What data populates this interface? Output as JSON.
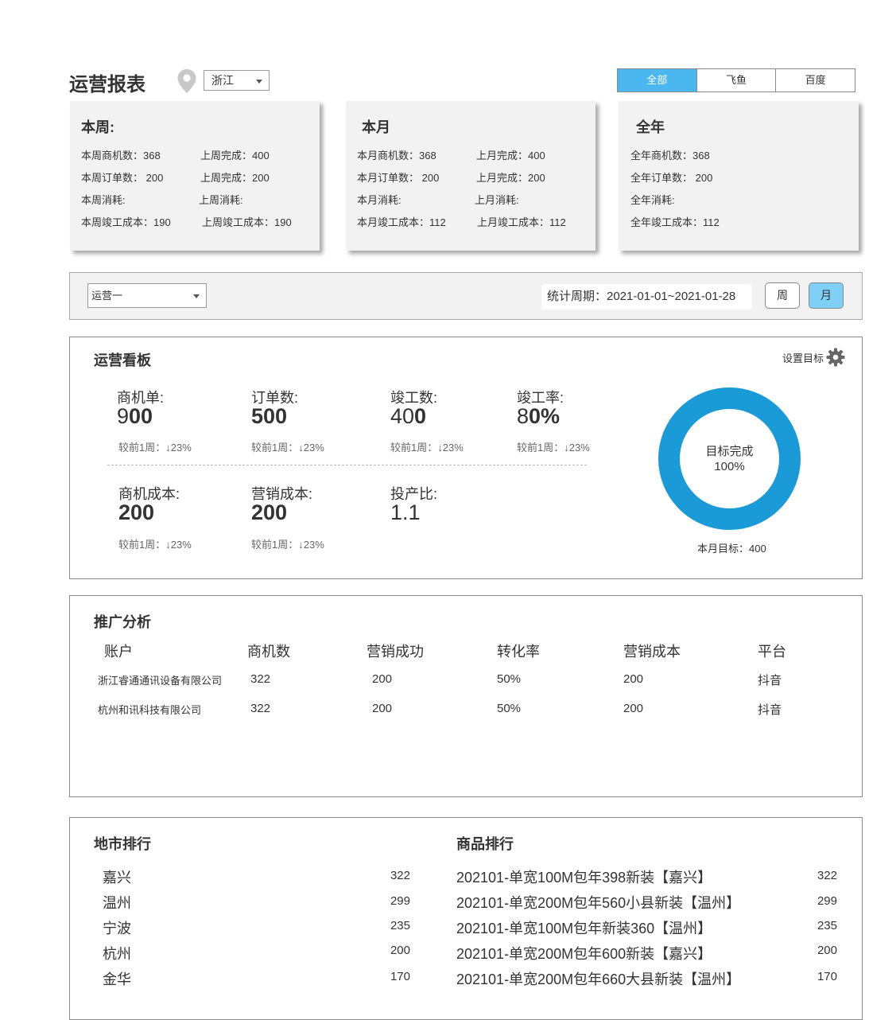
{
  "header": {
    "title": "运营报表",
    "province": "浙江",
    "platform_tabs": [
      "全部",
      "飞鱼",
      "百度"
    ]
  },
  "cards": [
    {
      "title": "本周:",
      "rows": [
        [
          "本周商机数：368",
          "上周完成：400"
        ],
        [
          "本周订单数： 200",
          "上周完成：200"
        ],
        [
          "本周消耗:",
          "上周消耗:"
        ],
        [
          "本周竣工成本：190",
          "上周竣工成本：190"
        ]
      ]
    },
    {
      "title": "本月",
      "rows": [
        [
          "本月商机数：368",
          "上月完成：400"
        ],
        [
          "本月订单数： 200",
          "上月完成：200"
        ],
        [
          "本月消耗:",
          "上月消耗:"
        ],
        [
          "本月竣工成本：112",
          "上月竣工成本：112"
        ]
      ]
    },
    {
      "title": "全年",
      "rows": [
        [
          "全年商机数：368",
          ""
        ],
        [
          "全年订单数： 200",
          ""
        ],
        [
          "全年消耗:",
          ""
        ],
        [
          "全年竣工成本：112",
          ""
        ]
      ]
    }
  ],
  "filter": {
    "operator": "运营一",
    "period": "统计周期：2021-01-01~2021-01-28",
    "week_label": "周",
    "month_label": "月"
  },
  "dashboard": {
    "title": "运营看板",
    "settings_label": "设置目标",
    "metrics": [
      {
        "label": "商机单:",
        "value_light": "9",
        "value_bold": "00",
        "cmp": "较前1周：↓23%"
      },
      {
        "label": "订单数:",
        "value_light": "",
        "value_bold": "500",
        "cmp": "较前1周：↓23%"
      },
      {
        "label": "竣工数:",
        "value_light": "40",
        "value_bold": "0",
        "cmp": "较前1周：↓23%"
      },
      {
        "label": "竣工率:",
        "value_light": "8",
        "value_bold": "0%",
        "cmp": "较前1周：↓23%"
      },
      {
        "label": "商机成本:",
        "value_light": "",
        "value_bold": "200",
        "cmp": "较前1周：↓23%"
      },
      {
        "label": "营销成本:",
        "value_light": "",
        "value_bold": "200",
        "cmp": "较前1周：↓23%"
      },
      {
        "label": "投产比:",
        "value_light": "1.1",
        "value_bold": "",
        "cmp": ""
      }
    ],
    "donut": {
      "label": "目标完成",
      "percent_text": "100%",
      "progress": 1.0,
      "color": "#1a9bd7"
    },
    "month_target": "本月目标：400"
  },
  "promotion": {
    "title": "推广分析",
    "columns": [
      "账户",
      "商机数",
      "营销成功",
      "转化率",
      "营销成本",
      "平台"
    ],
    "rows": [
      [
        "浙江睿通通讯设备有限公司",
        "322",
        "200",
        "50%",
        "200",
        "抖音"
      ],
      [
        "杭州和讯科技有限公司",
        "322",
        "200",
        "50%",
        "200",
        "抖音"
      ]
    ]
  },
  "city_rank": {
    "title": "地市排行",
    "items": [
      {
        "name": "嘉兴",
        "value": "322"
      },
      {
        "name": "温州",
        "value": "299"
      },
      {
        "name": "宁波",
        "value": "235"
      },
      {
        "name": "杭州",
        "value": "200"
      },
      {
        "name": "金华",
        "value": "170"
      }
    ]
  },
  "product_rank": {
    "title": "商品排行",
    "items": [
      {
        "name": "202101-单宽100M包年398新装【嘉兴】",
        "value": "322"
      },
      {
        "name": "202101-单宽200M包年560小县新装【温州】",
        "value": "299"
      },
      {
        "name": "202101-单宽100M包年新装360【温州】",
        "value": "235"
      },
      {
        "name": "202101-单宽200M包年600新装【嘉兴】",
        "value": "200"
      },
      {
        "name": "202101-单宽200M包年660大县新装【温州】",
        "value": "170"
      }
    ]
  }
}
